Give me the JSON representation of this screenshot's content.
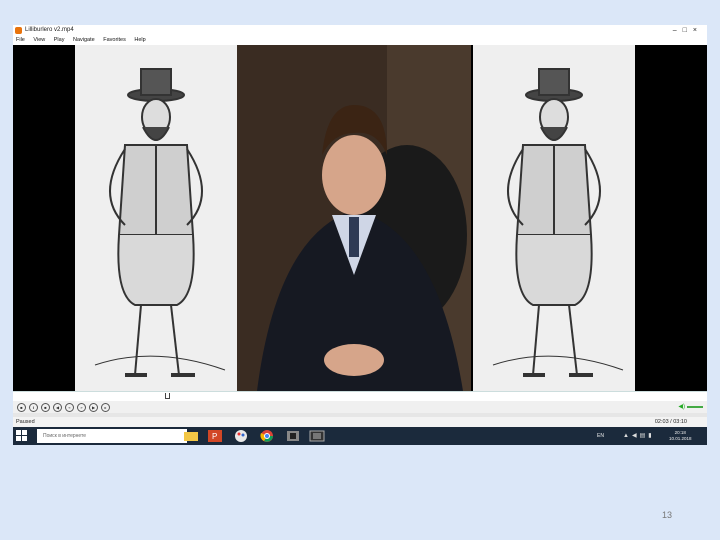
{
  "window": {
    "title": "Lilliburlero v2.mp4"
  },
  "menu": {
    "items": [
      "File",
      "View",
      "Play",
      "Navigate",
      "Favorites",
      "Help"
    ]
  },
  "status": {
    "state": "Paused",
    "time": "02:03 / 03:10"
  },
  "taskbar": {
    "search_placeholder": "Поиск в интернете",
    "language": "EN",
    "clock_time": "20:18",
    "clock_date": "10.01.2018"
  },
  "slide": {
    "page_number": "13"
  }
}
